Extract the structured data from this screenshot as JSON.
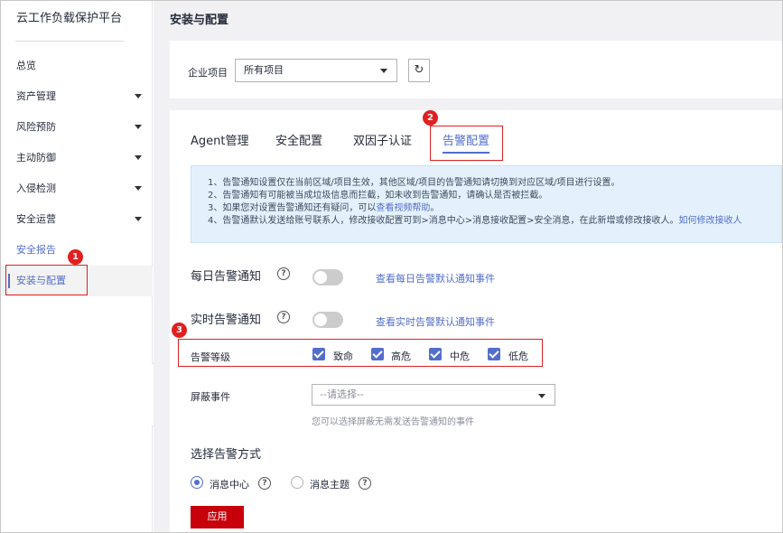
{
  "sidebar": {
    "title": "云工作负载保护平台",
    "items": [
      {
        "label": "总览",
        "caret": false
      },
      {
        "label": "资产管理",
        "caret": true
      },
      {
        "label": "风险预防",
        "caret": true
      },
      {
        "label": "主动防御",
        "caret": true
      },
      {
        "label": "入侵检测",
        "caret": true
      },
      {
        "label": "安全运营",
        "caret": true
      },
      {
        "label": "安全报告",
        "caret": false
      },
      {
        "label": "安装与配置",
        "caret": false,
        "active": true
      }
    ]
  },
  "page": {
    "title": "安装与配置",
    "project_label": "企业项目",
    "project_value": "所有项目",
    "refresh_icon": "↻"
  },
  "tabs": [
    "Agent管理",
    "安全配置",
    "双因子认证",
    "告警配置"
  ],
  "notice": {
    "lines": [
      "1、告警通知设置仅在当前区域/项目生效，其他区域/项目的告警通知请切换到对应区域/项目进行设置。",
      "2、告警通知有可能被当成垃圾信息而拦截，如未收到告警通知，请确认是否被拦截。",
      "3、如果您对设置告警通知还有疑问，可以",
      "4、告警通默认发送给账号联系人，修改接收配置可到>消息中心>消息接收配置>安全消息，在此新增或修改接收人。"
    ],
    "line3_link": "查看视频帮助",
    "line3_end": "。",
    "line4_link": "如何修改接收人"
  },
  "daily": {
    "title": "每日告警通知",
    "link": "查看每日告警默认通知事件"
  },
  "realtime": {
    "title": "实时告警通知",
    "link": "查看实时告警默认通知事件"
  },
  "level": {
    "label": "告警等级",
    "options": [
      "致命",
      "高危",
      "中危",
      "低危"
    ]
  },
  "mask": {
    "label": "屏蔽事件",
    "placeholder": "--请选择--",
    "hint": "您可以选择屏蔽无需发送告警通知的事件"
  },
  "method": {
    "title": "选择告警方式",
    "options": [
      "消息中心",
      "消息主题"
    ],
    "selected": "消息中心"
  },
  "apply_label": "应用",
  "help_glyph": "?",
  "badges": [
    "1",
    "2",
    "3"
  ],
  "colors": {
    "accent": "#526ecc",
    "apply": "#c7000b",
    "annotation": "#e02020",
    "notice_bg": "#e4f1fc"
  }
}
